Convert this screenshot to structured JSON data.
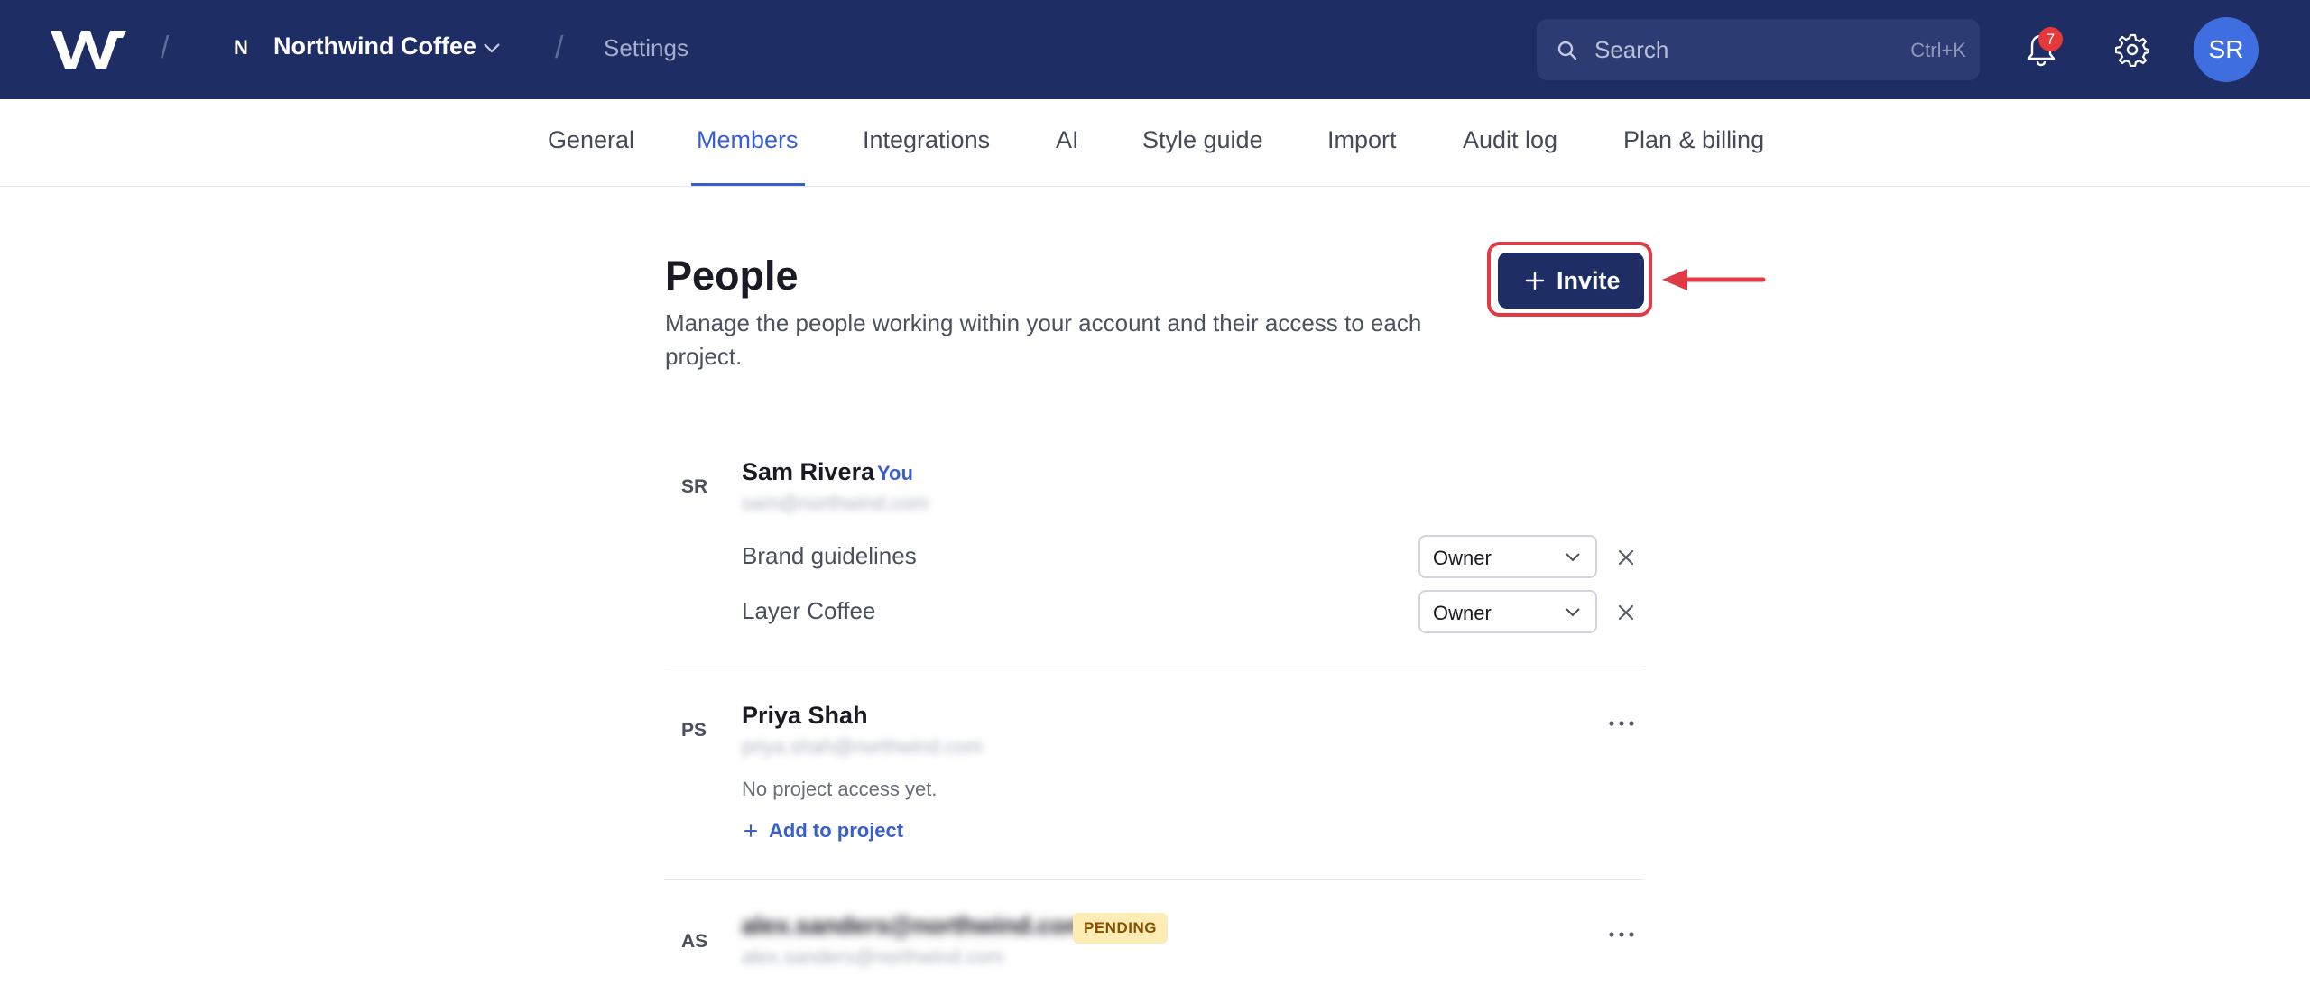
{
  "topbar": {
    "workspace_initial": "N",
    "workspace_name": "Northwind Coffee",
    "breadcrumb_separator": "/",
    "breadcrumb_page": "Settings",
    "search_placeholder": "Search",
    "search_shortcut": "Ctrl+K",
    "notification_count": "7",
    "user_initials": "SR",
    "colors": {
      "background": "#1e2d63",
      "search_bg": "#2c3c72",
      "badge": "#e5383b",
      "avatar": "#3e6ee0"
    }
  },
  "tabs": [
    {
      "label": "General",
      "active": false
    },
    {
      "label": "Members",
      "active": true
    },
    {
      "label": "Integrations",
      "active": false
    },
    {
      "label": "AI",
      "active": false
    },
    {
      "label": "Style guide",
      "active": false
    },
    {
      "label": "Import",
      "active": false
    },
    {
      "label": "Audit log",
      "active": false
    },
    {
      "label": "Plan & billing",
      "active": false
    }
  ],
  "header": {
    "title": "People",
    "subtitle": "Manage the people working within your account and their access to each project.",
    "invite_label": "Invite"
  },
  "members": [
    {
      "initials": "SR",
      "name": "Sam Rivera",
      "you_label": "You",
      "email": "sam@northwind.com",
      "projects": [
        {
          "name": "Brand guidelines",
          "role": "Owner"
        },
        {
          "name": "Layer Coffee",
          "role": "Owner"
        }
      ]
    },
    {
      "initials": "PS",
      "name": "Priya Shah",
      "email": "priya.shah@northwind.com",
      "no_access": "No project access yet.",
      "add_label": "Add to project"
    },
    {
      "initials": "AS",
      "email": "alex.sanders@northwind.com",
      "email_secondary": "alex.sanders@northwind.com",
      "status": "PENDING"
    }
  ],
  "icons": [
    "logo",
    "chevron-down-icon",
    "search-icon",
    "bell-icon",
    "gear-icon",
    "plus-icon",
    "arrow-left-icon",
    "close-icon",
    "more-horizontal-icon"
  ],
  "accent_color": "#3a5fcd",
  "annotation_color": "#e03a46"
}
